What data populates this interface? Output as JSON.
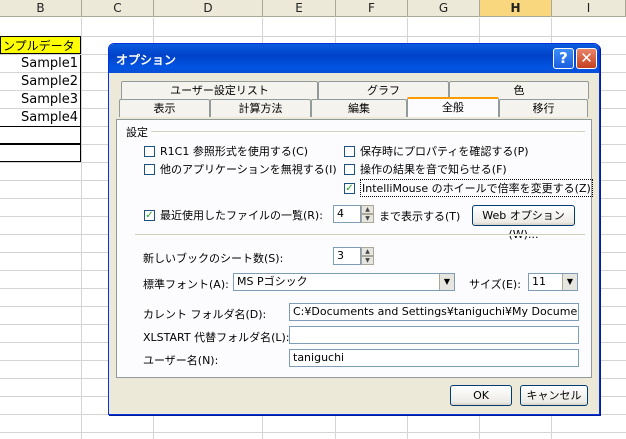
{
  "sheet": {
    "columns": [
      {
        "label": "B",
        "selected": false
      },
      {
        "label": "C",
        "selected": false
      },
      {
        "label": "D",
        "selected": false
      },
      {
        "label": "E",
        "selected": false
      },
      {
        "label": "F",
        "selected": false
      },
      {
        "label": "G",
        "selected": false
      },
      {
        "label": "H",
        "selected": true
      },
      {
        "label": "I",
        "selected": false
      }
    ],
    "title_cell": "ンプルデータ",
    "samples": [
      "Sample1",
      "Sample2",
      "Sample3",
      "Sample4"
    ],
    "colors": {
      "title_fill": "#ffff00",
      "header_bg": "#ece9d8",
      "selected_header": "#f9d77e"
    }
  },
  "dialog": {
    "title": "オプション",
    "help_glyph": "?",
    "close_glyph": "✕",
    "tabs_back": [
      "ユーザー設定リスト",
      "グラフ",
      "色"
    ],
    "tabs_front": [
      "表示",
      "計算方法",
      "編集",
      "全般",
      "移行"
    ],
    "active_tab": "全般",
    "group_label": "設定",
    "checkboxes": {
      "r1c1": {
        "label": "R1C1 参照形式を使用する(C)",
        "checked": false
      },
      "ignore_apps": {
        "label": "他のアプリケーションを無視する(I)",
        "checked": false
      },
      "prompt_props": {
        "label": "保存時にプロパティを確認する(P)",
        "checked": false
      },
      "sound": {
        "label": "操作の結果を音で知らせる(F)",
        "checked": false
      },
      "intellimouse": {
        "label": "IntelliMouse のホイールで倍率を変更する(Z)",
        "checked": true
      },
      "recent_files": {
        "label": "最近使用したファイルの一覧(R):",
        "checked": true
      }
    },
    "recent_count": "4",
    "recent_suffix": "まで表示する(T)",
    "web_options_button": "Web オプション(W)...",
    "sheets_label": "新しいブックのシート数(S):",
    "sheets_value": "3",
    "font_label": "標準フォント(A):",
    "font_value": "MS Pゴシック",
    "size_label": "サイズ(E):",
    "size_value": "11",
    "default_folder_label": "カレント フォルダ名(D):",
    "default_folder_value": "C:¥Documents and Settings¥taniguchi¥My Documents",
    "xlstart_label": "XLSTART 代替フォルダ名(L):",
    "xlstart_value": "",
    "username_label": "ユーザー名(N):",
    "username_value": "taniguchi",
    "ok_button": "OK",
    "cancel_button": "キャンセル",
    "spin_up": "▲",
    "spin_down": "▼",
    "combo_arrow": "▼"
  }
}
